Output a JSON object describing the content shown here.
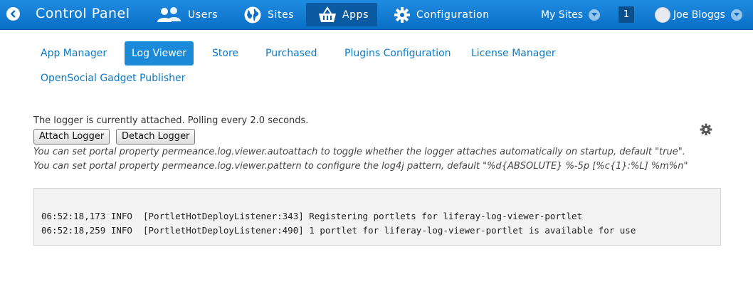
{
  "header": {
    "title": "Control Panel",
    "back_icon": "chevron-left-circle-icon",
    "nav": [
      {
        "label": "Users",
        "icon": "users-icon",
        "active": false
      },
      {
        "label": "Sites",
        "icon": "globe-icon",
        "active": false
      },
      {
        "label": "Apps",
        "icon": "basket-icon",
        "active": true
      },
      {
        "label": "Configuration",
        "icon": "gear-icon",
        "active": false
      }
    ],
    "my_sites": "My Sites",
    "notifications": "1",
    "user_name": "Joe Bloggs"
  },
  "tabs": [
    {
      "label": "App Manager",
      "active": false
    },
    {
      "label": "Log Viewer",
      "active": true
    },
    {
      "label": "Store",
      "active": false
    },
    {
      "label": "Purchased",
      "active": false
    },
    {
      "label": "Plugins Configuration",
      "active": false
    },
    {
      "label": "License Manager",
      "active": false
    },
    {
      "label": "OpenSocial Gadget Publisher",
      "active": false
    }
  ],
  "logger": {
    "status": "The logger is currently attached. Polling every 2.0 seconds.",
    "attach_label": "Attach Logger",
    "detach_label": "Detach Logger",
    "note_autoattach": "You can set portal property permeance.log.viewer.autoattach to toggle whether the logger attaches automatically on startup, default \"true\".",
    "note_pattern": "You can set portal property permeance.log.viewer.pattern to configure the log4j pattern, default \"%d{ABSOLUTE} %-5p [%c{1}:%L] %m%n\""
  },
  "log_lines": [
    "06:52:18,173 INFO  [PortletHotDeployListener:343] Registering portlets for liferay-log-viewer-portlet",
    "06:52:18,259 INFO  [PortletHotDeployListener:490] 1 portlet for liferay-log-viewer-portlet is available for use"
  ],
  "colors": {
    "topbar": "#0a6fc7",
    "link": "#0a7ac8",
    "active_tab": "#1a8ad9"
  }
}
